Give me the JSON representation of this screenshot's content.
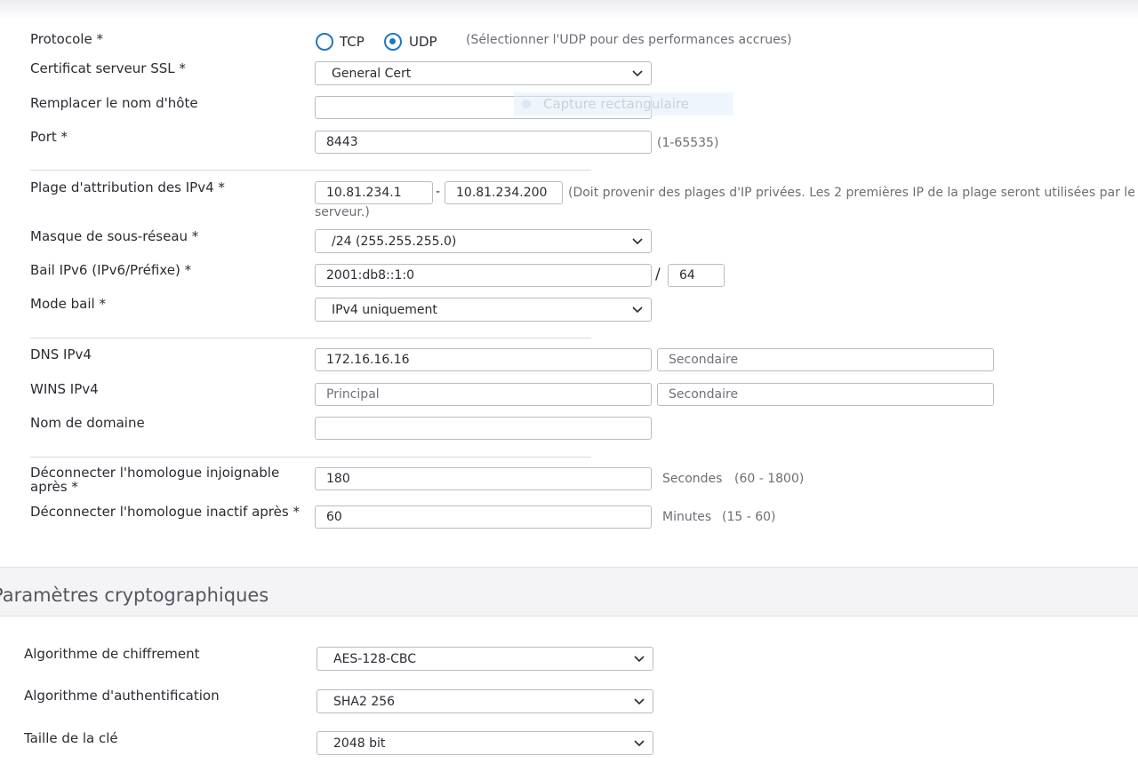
{
  "top": {
    "protocol": {
      "label": "Protocole *",
      "options": [
        "TCP",
        "UDP"
      ],
      "selected": "UDP",
      "hint": "(Sélectionner l'UDP pour des performances accrues)"
    },
    "ssl_cert": {
      "label": "Certificat serveur SSL *",
      "value": "General Cert"
    },
    "override_hostname": {
      "label": "Remplacer le nom d'hôte",
      "value": ""
    },
    "port": {
      "label": "Port *",
      "value": "8443",
      "hint": "(1-65535)"
    },
    "ipv4_range": {
      "label": "Plage d'attribution des IPv4 *",
      "start": "10.81.234.1",
      "dash": "-",
      "end": "10.81.234.200",
      "hint_line1": "(Doit provenir des plages d'IP privées. Les 2 premières IP de la plage seront utilisées par le",
      "hint_line2": "serveur.)"
    },
    "subnet_mask": {
      "label": "Masque de sous-réseau *",
      "value": "/24 (255.255.255.0)"
    },
    "ipv6_lease": {
      "label": "Bail IPv6 (IPv6/Préfixe) *",
      "value": "2001:db8::1:0",
      "slash": "/",
      "prefix": "64"
    },
    "lease_mode": {
      "label": "Mode bail *",
      "value": "IPv4 uniquement"
    },
    "dns_ipv4": {
      "label": "DNS IPv4",
      "primary": "172.16.16.16",
      "secondary_placeholder": "Secondaire"
    },
    "wins_ipv4": {
      "label": "WINS IPv4",
      "primary_placeholder": "Principal",
      "secondary_placeholder": "Secondaire"
    },
    "domain_name": {
      "label": "Nom de domaine",
      "value": ""
    },
    "dead_peer": {
      "label_line1": "Déconnecter l'homologue injoignable",
      "label_line2": "après *",
      "value": "180",
      "unit": "Secondes",
      "range": "(60 - 1800)"
    },
    "idle_peer": {
      "label": "Déconnecter l'homologue inactif après *",
      "value": "60",
      "unit": "Minutes",
      "range": "(15 - 60)"
    }
  },
  "overlay": {
    "text": "Capture rectangulaire"
  },
  "crypto": {
    "title": "Paramètres cryptographiques",
    "encryption": {
      "label": "Algorithme de chiffrement",
      "value": "AES-128-CBC"
    },
    "authentication": {
      "label": "Algorithme d'authentification",
      "value": "SHA2 256"
    },
    "key_size": {
      "label": "Taille de la clé",
      "value": "2048 bit"
    }
  },
  "colors": {
    "accent": "#1f77c4",
    "border": "#b9bcc4",
    "text": "#2b2b33",
    "hint": "#6b6e76"
  },
  "icons": {
    "dropdown": "chevron-down-icon"
  }
}
